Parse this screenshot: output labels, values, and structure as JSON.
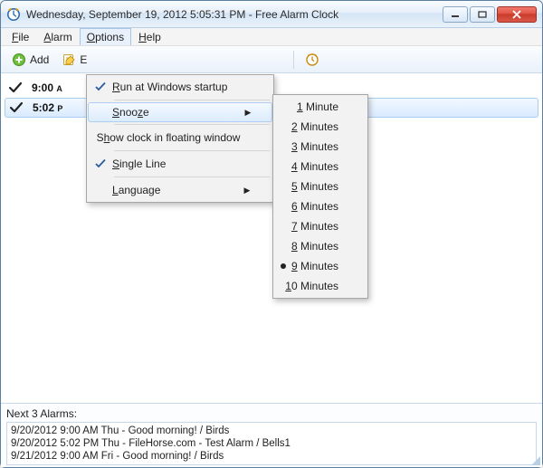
{
  "window": {
    "title": "Wednesday, September 19, 2012 5:05:31 PM - Free Alarm Clock"
  },
  "menubar": {
    "file": "File",
    "alarm": "Alarm",
    "options": "Options",
    "help": "Help"
  },
  "toolbar": {
    "add": "Add",
    "edit_partial": "E"
  },
  "options_menu": {
    "run_startup": "Run at Windows startup",
    "snooze": "Snooze",
    "floating": "Show clock in floating window",
    "single_line": "Single Line",
    "language": "Language"
  },
  "snooze_menu": {
    "items": [
      {
        "label": "1 Minute"
      },
      {
        "label": "2 Minutes"
      },
      {
        "label": "3 Minutes"
      },
      {
        "label": "4 Minutes"
      },
      {
        "label": "5 Minutes"
      },
      {
        "label": "6 Minutes"
      },
      {
        "label": "7 Minutes"
      },
      {
        "label": "8 Minutes"
      },
      {
        "label": "9 Minutes",
        "selected": true
      },
      {
        "label": "10 Minutes"
      }
    ]
  },
  "alarms": [
    {
      "time": "9:00",
      "ampm": "A"
    },
    {
      "time": "5:02",
      "ampm": "P"
    }
  ],
  "status": {
    "header": "Next 3 Alarms:",
    "lines": [
      "9/20/2012 9:00 AM Thu - Good morning! / Birds",
      "9/20/2012 5:02 PM Thu - FileHorse.com - Test Alarm / Bells1",
      "9/21/2012 9:00 AM Fri - Good morning! / Birds"
    ]
  }
}
